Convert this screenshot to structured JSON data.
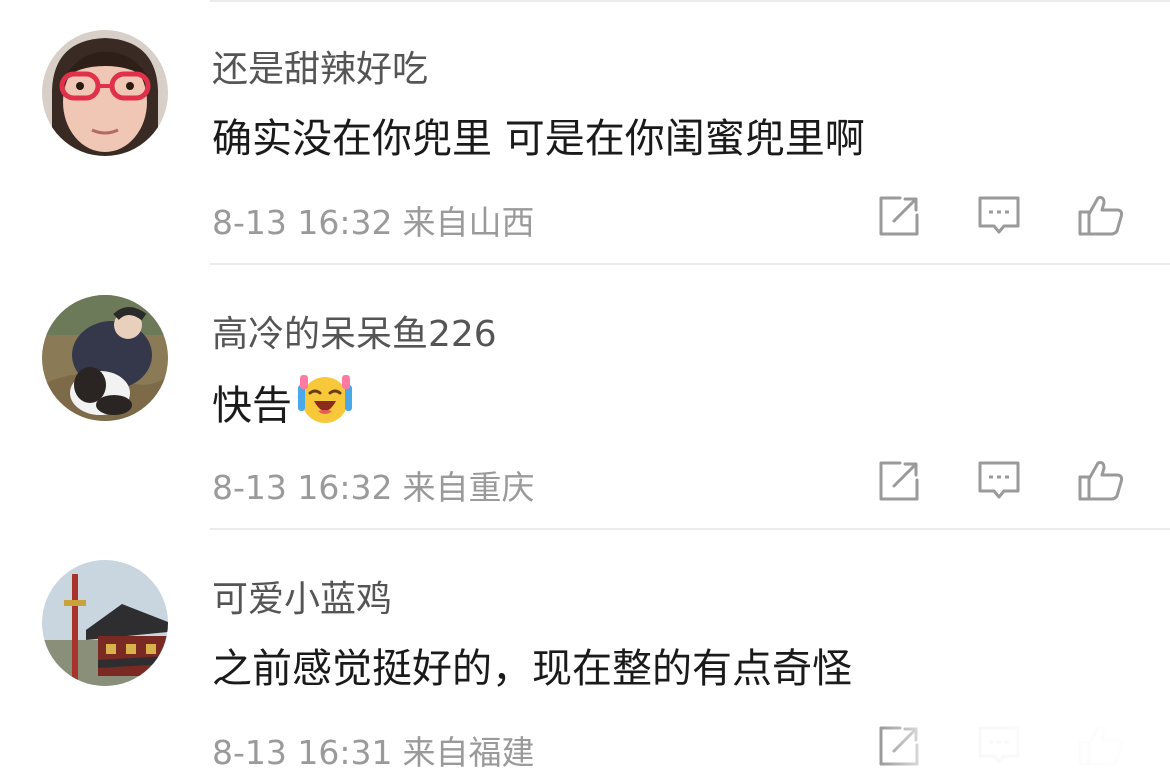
{
  "comments": [
    {
      "username": "还是甜辣好吃",
      "text": "确实没在你兜里 可是在你闺蜜兜里啊",
      "time": "8-13 16:32",
      "location": "来自山西"
    },
    {
      "username": "高冷的呆呆鱼226",
      "text": "快告",
      "emoji": "laughing-tears-emoji",
      "time": "8-13 16:32",
      "location": "来自重庆"
    },
    {
      "username": "可爱小蓝鸡",
      "text": "之前感觉挺好的，现在整的有点奇怪",
      "time": "8-13 16:31",
      "location": "来自福建"
    }
  ],
  "icons": {
    "repost": "repost-icon",
    "reply": "comment-icon",
    "like": "thumbs-up-icon"
  },
  "colors": {
    "username": "#555555",
    "text": "#1a1a1a",
    "meta": "#9a9a9a",
    "icon": "#9a9a9a",
    "divider": "#ececec"
  }
}
